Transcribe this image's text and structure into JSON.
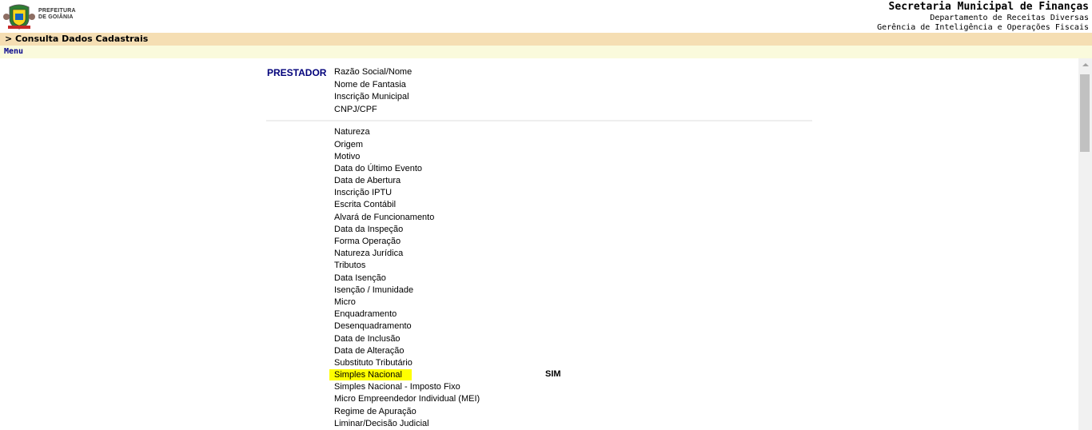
{
  "header": {
    "logo_text_line1": "PREFEITURA",
    "logo_text_line2": "DE GOIÂNIA",
    "title": "Secretaria Municipal de Finanças",
    "subtitle1": "Departamento de Receitas Diversas",
    "subtitle2": "Gerência de Inteligência e Operações Fiscais"
  },
  "breadcrumb": "> Consulta Dados Cadastrais",
  "menu_label": "Menu",
  "section_label": "PRESTADOR",
  "group1": [
    "Razão Social/Nome",
    "Nome de Fantasia",
    "Inscrição Municipal",
    "CNPJ/CPF"
  ],
  "group2": [
    "Natureza",
    "Origem",
    "Motivo",
    "Data do Último Evento",
    "Data de Abertura",
    "Inscrição IPTU",
    "Escrita Contábil",
    "Alvará de Funcionamento",
    "Data da Inspeção",
    "Forma Operação",
    "Natureza Jurídica",
    "Tributos",
    "Data Isenção",
    "Isenção / Imunidade",
    "Micro",
    "Enquadramento",
    "Desenquadramento",
    "Data de Inclusão",
    "Data de Alteração",
    "Substituto Tributário",
    "Simples Nacional",
    "Simples Nacional - Imposto Fixo",
    "Micro Empreendedor Individual (MEI)",
    "Regime de Apuração",
    "Liminar/Decisão Judicial"
  ],
  "simples_value": "SIM",
  "highlight_color": "#ffff00",
  "bar_color": "#f5deb3",
  "menu_bar_color": "#fafadc"
}
